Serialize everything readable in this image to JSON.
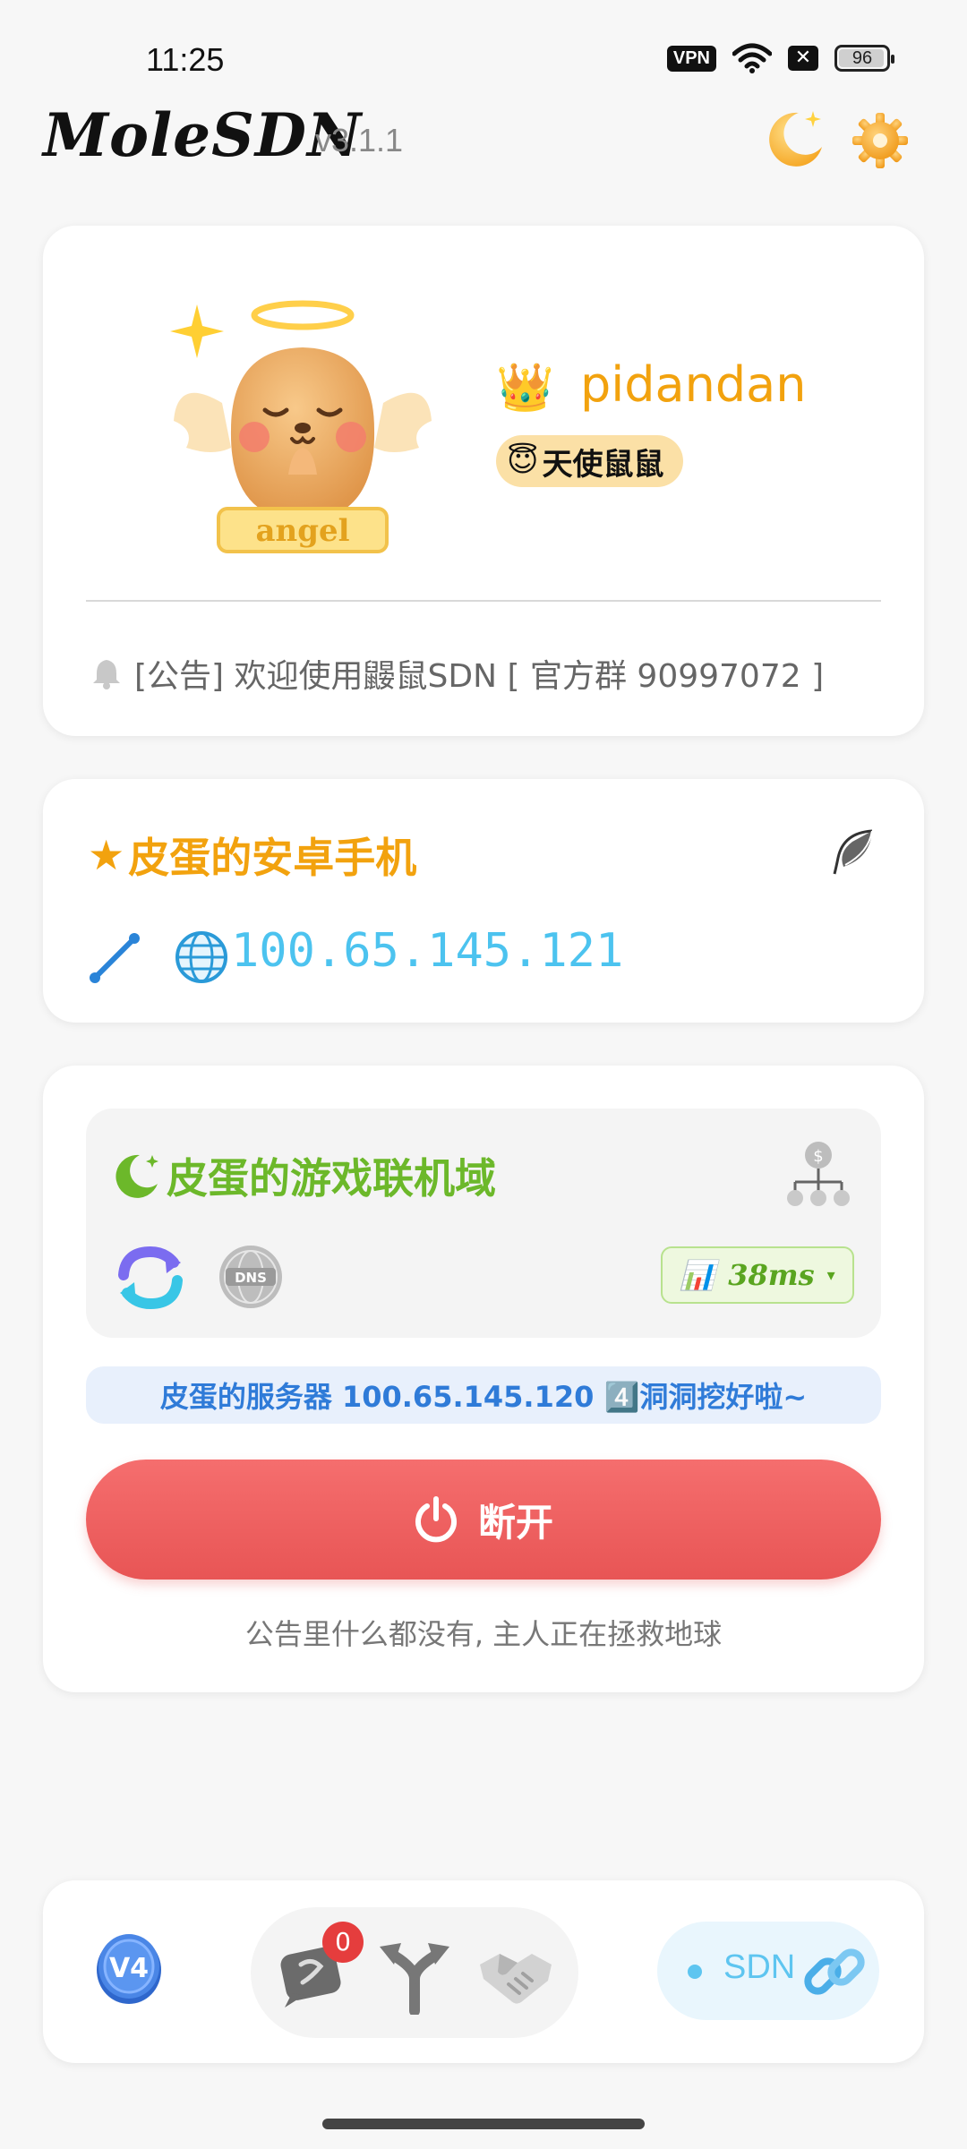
{
  "status_bar": {
    "time": "11:25",
    "vpn_label": "VPN",
    "battery_percent": "96",
    "battery_level": 0.96
  },
  "header": {
    "app_name": "MoleSDN",
    "version": "v3.1.1",
    "icons": [
      "moon-icon",
      "gear-icon"
    ]
  },
  "profile": {
    "username": "pidandan",
    "title_emoji": "😇",
    "title": "天使鼠鼠",
    "crown": "👑",
    "mascot_label": "angel",
    "notice": "[公告] 欢迎使用鼹鼠SDN [ 官方群 90997072 ]"
  },
  "device": {
    "star": "★",
    "name": "皮蛋的安卓手机",
    "globe": "🌐",
    "ip": "100.65.145.121"
  },
  "network": {
    "name": "皮蛋的游戏联机域",
    "dns_label": "DNS",
    "latency_icon": "📊",
    "latency": "38ms",
    "caret": "▾",
    "server_message": "皮蛋的服务器 100.65.145.120 4️⃣洞洞挖好啦~",
    "disconnect_label": "断开",
    "footer_note": "公告里什么都没有, 主人正在拯救地球"
  },
  "bottom_bar": {
    "v4_label": "V4",
    "message_count": "0",
    "sdn_label": "SDN"
  },
  "colors": {
    "accent_orange": "#f2a20e",
    "accent_green": "#6cb82a",
    "ip_blue": "#4cc3ef",
    "danger_red": "#e85555",
    "banner_blue": "#2f7bd8"
  }
}
